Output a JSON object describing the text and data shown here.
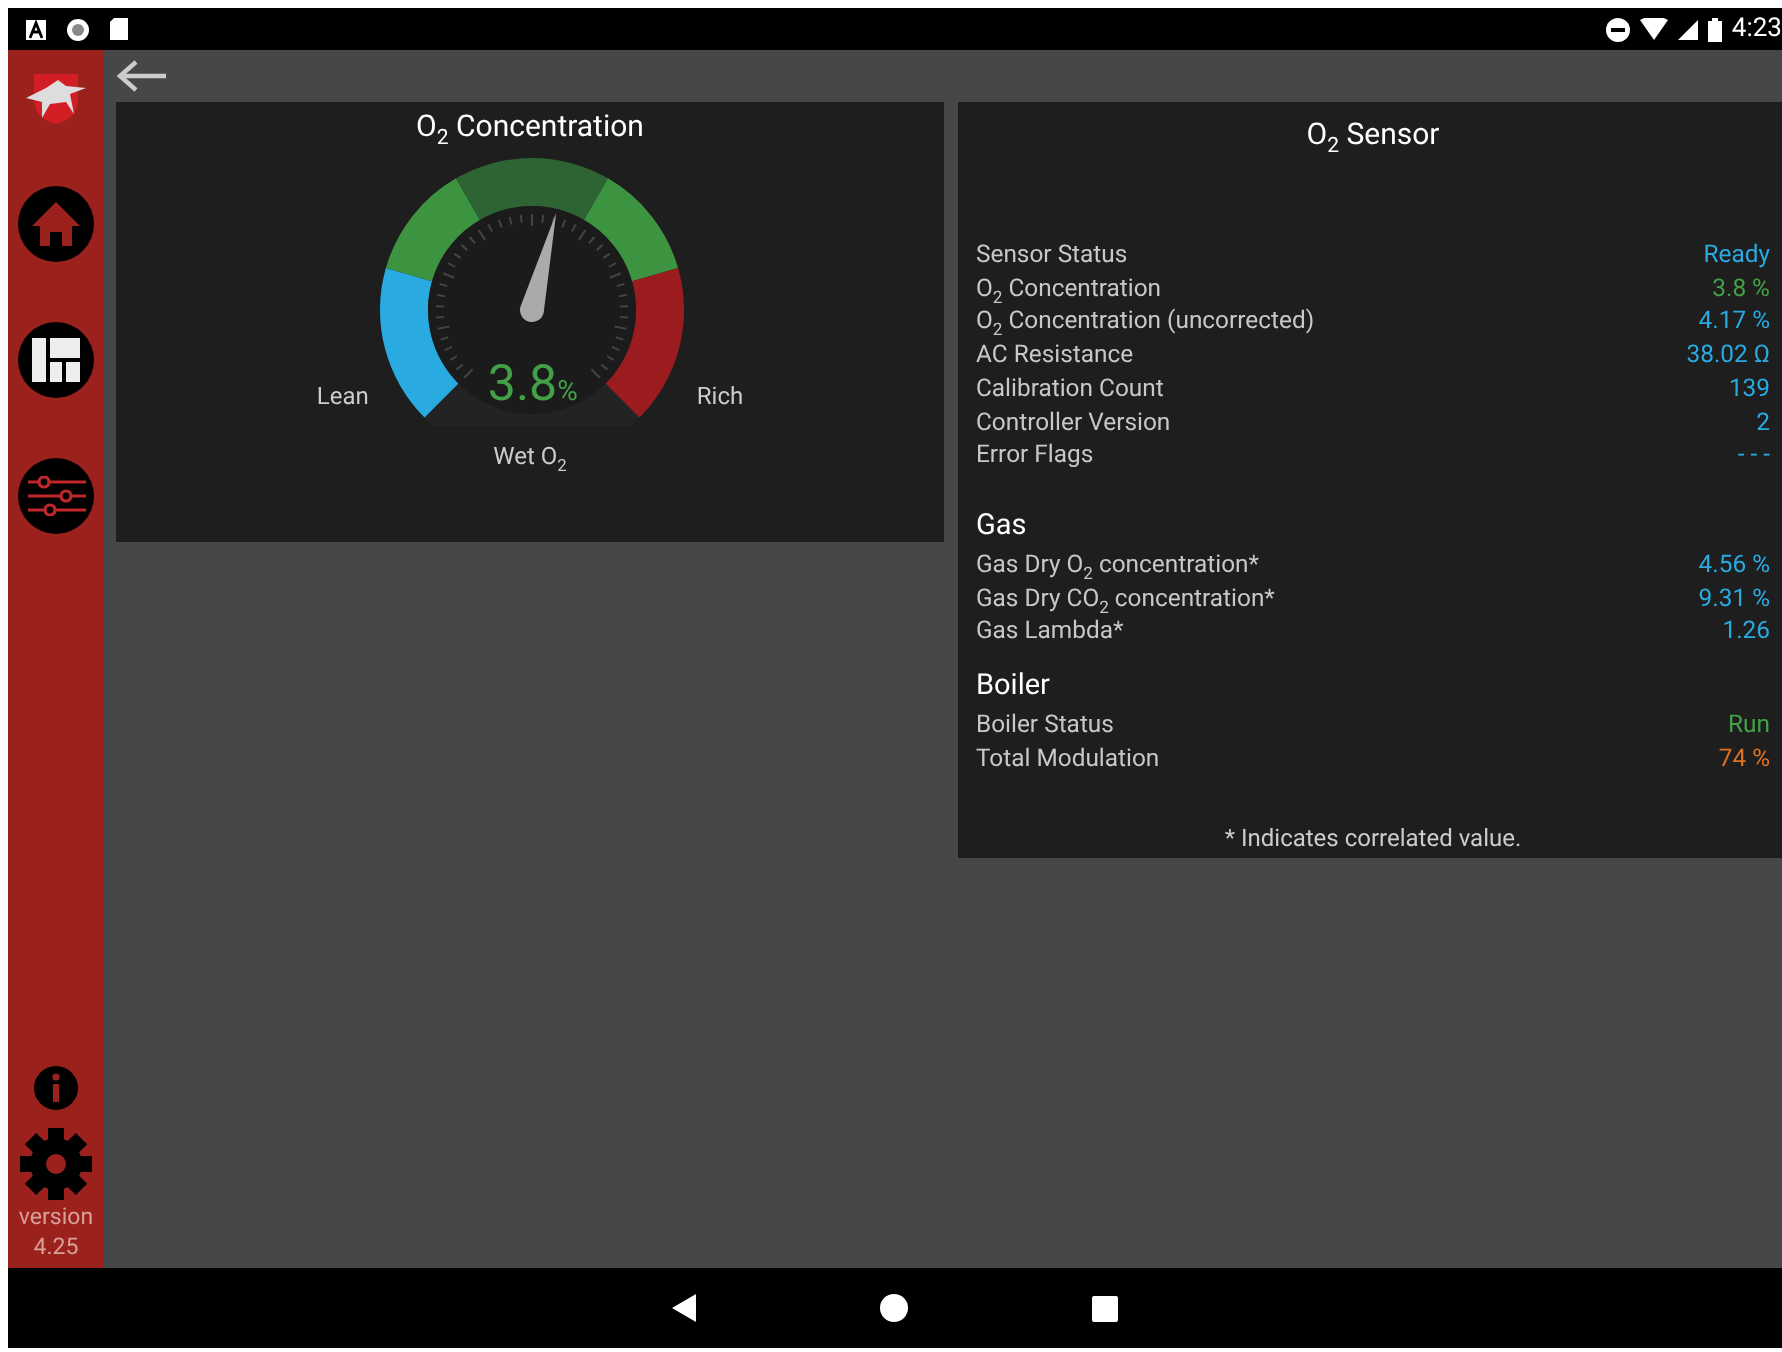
{
  "status_bar": {
    "time": "4:23"
  },
  "sidebar": {
    "version_label": "version",
    "version": "4.25"
  },
  "gauge_card": {
    "title": "O$_{2}$ Concentration",
    "left_label": "Lean",
    "right_label": "Rich",
    "value": "3.8",
    "unit": "%",
    "caption": "Wet O$_{2}$"
  },
  "sensor_card": {
    "title": "O$_{2}$ Sensor",
    "rows": [
      {
        "label": "Sensor Status",
        "value": "Ready",
        "color": "#29abe2"
      },
      {
        "label": "O$_{2}$ Concentration",
        "value": "3.8 %",
        "color": "#43a047"
      },
      {
        "label": "O$_{2}$ Concentration (uncorrected)",
        "value": "4.17 %",
        "color": "#29abe2"
      },
      {
        "label": "AC Resistance",
        "value": "38.02 Ω",
        "color": "#29abe2"
      },
      {
        "label": "Calibration Count",
        "value": "139",
        "color": "#29abe2"
      },
      {
        "label": "Controller Version",
        "value": "2",
        "color": "#29abe2"
      },
      {
        "label": "Error Flags",
        "value": "- - -",
        "color": "#29abe2"
      }
    ],
    "sections": [
      {
        "heading": "Gas",
        "rows": [
          {
            "label": "Gas Dry O$_{2}$ concentration*",
            "value": "4.56 %",
            "color": "#29abe2"
          },
          {
            "label": "Gas Dry CO$_{2}$ concentration*",
            "value": "9.31 %",
            "color": "#29abe2"
          },
          {
            "label": "Gas Lambda*",
            "value": "1.26",
            "color": "#29abe2"
          }
        ]
      },
      {
        "heading": "Boiler",
        "rows": [
          {
            "label": "Boiler Status",
            "value": "Run",
            "color": "#43a047"
          },
          {
            "label": "Total Modulation",
            "value": "74 %",
            "color": "#e07020"
          }
        ]
      }
    ],
    "footnote": "* Indicates correlated value."
  }
}
